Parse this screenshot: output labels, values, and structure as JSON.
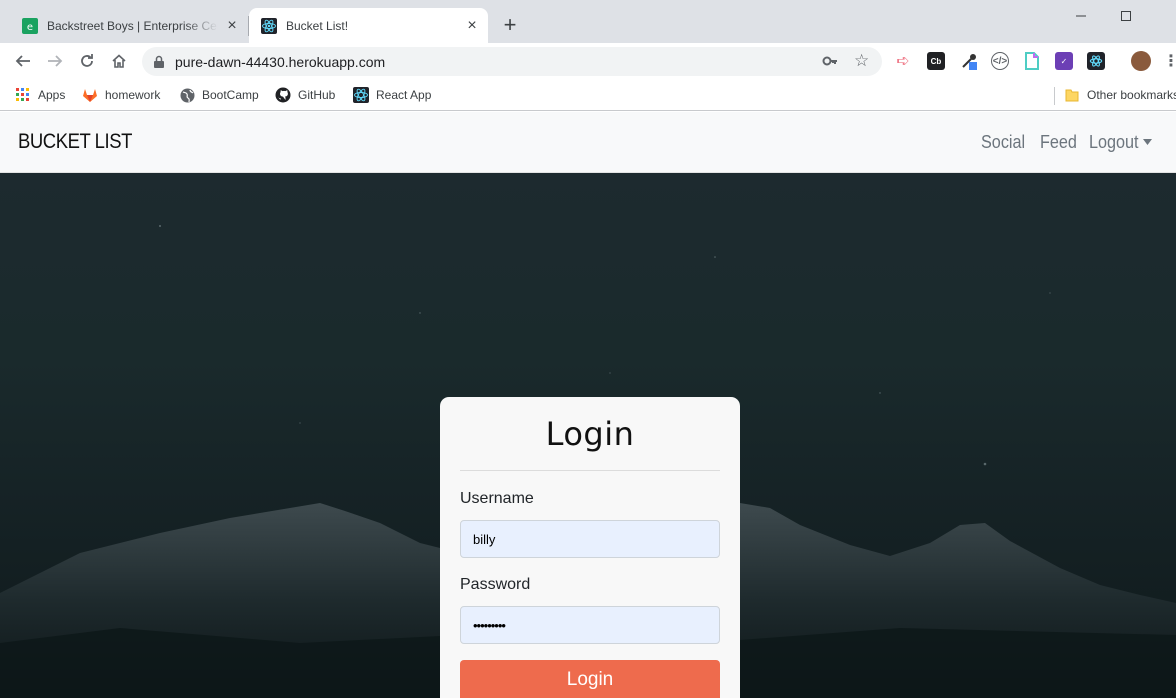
{
  "browser": {
    "tabs": [
      {
        "title": "Backstreet Boys | Enterprise Center",
        "active": false
      },
      {
        "title": "Bucket List!",
        "active": true
      }
    ],
    "url": "pure-dawn-44430.herokuapp.com",
    "bookmarks": [
      {
        "label": "Apps",
        "icon": "apps-grid-icon"
      },
      {
        "label": "homework",
        "icon": "gitlab-icon"
      },
      {
        "label": "BootCamp",
        "icon": "globe-icon"
      },
      {
        "label": "GitHub",
        "icon": "github-icon"
      },
      {
        "label": "React App",
        "icon": "react-icon"
      }
    ],
    "other_bookmarks": "Other bookmarks"
  },
  "app": {
    "brand": "BUCKET LIST",
    "nav": {
      "social": "Social",
      "feed": "Feed",
      "logout": "Logout"
    }
  },
  "login": {
    "title": "Login",
    "username_label": "Username",
    "username_value": "billy",
    "password_label": "Password",
    "password_value": "•••••••••",
    "submit_label": "Login"
  },
  "colors": {
    "accent": "#ee6b4d",
    "navbar_bg": "#f8f9fa",
    "input_bg": "#e8f0fe"
  }
}
